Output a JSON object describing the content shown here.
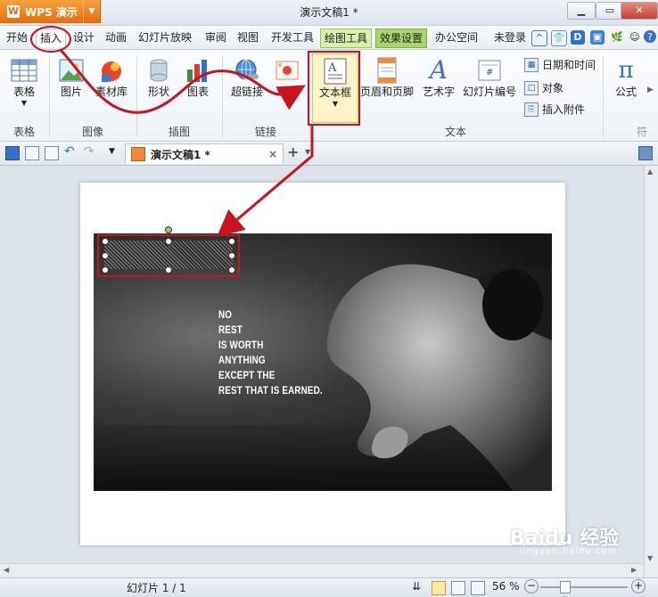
{
  "app": {
    "name": "WPS 演示",
    "title": "演示文稿1 *"
  },
  "menu": {
    "items": [
      "开始",
      "插入",
      "设计",
      "动画",
      "幻灯片放映",
      "审阅",
      "视图",
      "开发工具",
      "绘图工具",
      "效果设置",
      "办公空间"
    ],
    "login": "未登录"
  },
  "ribbon": {
    "groups": [
      {
        "label": "表格",
        "buttons": [
          "表格"
        ]
      },
      {
        "label": "图像",
        "buttons": [
          "图片",
          "素材库"
        ]
      },
      {
        "label": "插图",
        "buttons": [
          "形状",
          "图表"
        ]
      },
      {
        "label": "链接",
        "buttons": [
          "超链接",
          "动作"
        ]
      },
      {
        "label": "文本",
        "buttons": [
          "文本框",
          "页眉和页脚",
          "艺术字",
          "幻灯片编号"
        ],
        "small": [
          "日期和时间",
          "对象",
          "插入附件"
        ]
      },
      {
        "label": "符",
        "buttons": [
          "公式"
        ]
      }
    ]
  },
  "tabs": {
    "doc_tab": "演示文稿1 *"
  },
  "slide": {
    "poster_lines": [
      "NO",
      "REST",
      "IS WORTH",
      "ANYTHING",
      "EXCEPT THE",
      "REST THAT IS EARNED."
    ]
  },
  "status": {
    "slide_counter": "幻灯片 1 / 1",
    "zoom": "56 %"
  },
  "watermark": {
    "text": "Baidu 经验",
    "sub": "jingyan.baidu.com"
  },
  "colors": {
    "accent_orange": "#e66d0d",
    "annotation_red": "#c8141e",
    "draw_tools_green": "#d8f0a8",
    "effect_green": "#a8d66a"
  }
}
